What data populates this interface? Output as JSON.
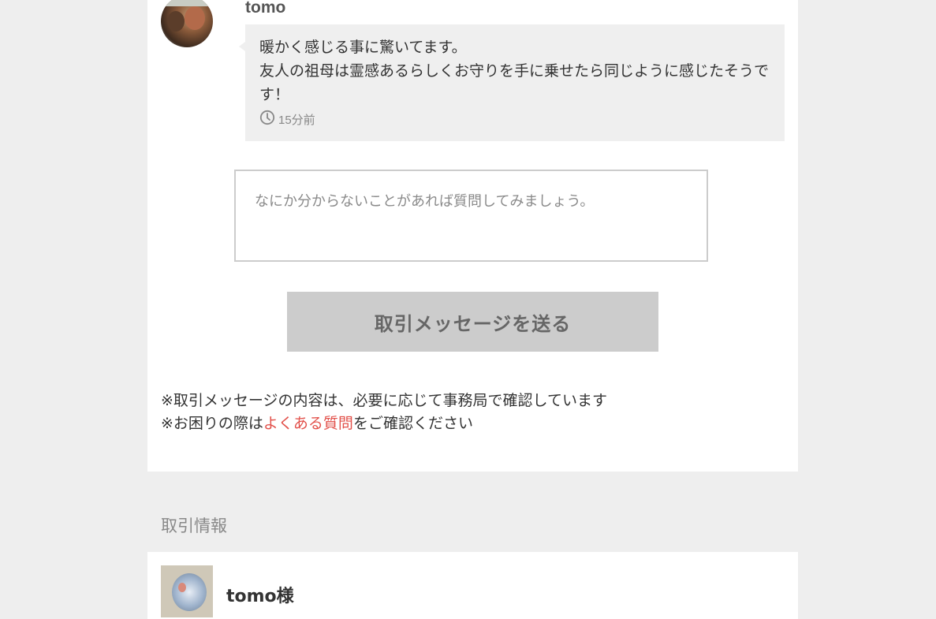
{
  "message": {
    "username": "tomo",
    "lines": [
      "暖かく感じる事に驚いてます。",
      "友人の祖母は霊感あるらしくお守りを手に乗せたら同じように感じたそうです！"
    ],
    "timestamp": "15分前"
  },
  "compose": {
    "placeholder": "なにか分からないことがあれば質問してみましょう。",
    "send_label": "取引メッセージを送る"
  },
  "notes": {
    "line1": "※取引メッセージの内容は、必要に応じて事務局で確認しています",
    "line2_prefix": "※お困りの際は",
    "faq_link": "よくある質問",
    "line2_suffix": "をご確認ください"
  },
  "transaction_info": {
    "title": "取引情報",
    "user_name": "tomo様"
  },
  "colors": {
    "link": "#e2504a",
    "button_bg": "#cccccc",
    "bubble_bg": "#efefef"
  }
}
